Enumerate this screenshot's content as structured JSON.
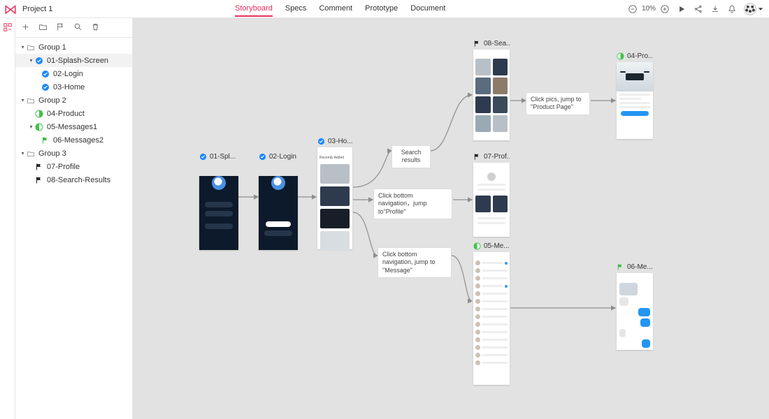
{
  "project_name": "Project 1",
  "tabs": [
    "Storyboard",
    "Specs",
    "Comment",
    "Prototype",
    "Document"
  ],
  "active_tab": 0,
  "zoom": "10%",
  "sidebar": {
    "groups": [
      {
        "label": "Group 1",
        "items": [
          {
            "label": "01-Splash-Screen",
            "status": "check-blue",
            "children": [
              {
                "label": "02-Login",
                "status": "check-blue"
              },
              {
                "label": "03-Home",
                "status": "check-blue"
              }
            ]
          }
        ]
      },
      {
        "label": "Group 2",
        "items": [
          {
            "label": "04-Product",
            "status": "half-green"
          },
          {
            "label": "05-Messages1",
            "status": "half-green-alt",
            "children": [
              {
                "label": "06-Messages2",
                "status": "flag-green"
              }
            ]
          }
        ]
      },
      {
        "label": "Group 3",
        "items": [
          {
            "label": "07-Profile",
            "status": "flag-black"
          },
          {
            "label": "08-Search-Results",
            "status": "flag-black"
          }
        ]
      }
    ]
  },
  "canvas": {
    "nodes": {
      "n01": {
        "label": "01-Spl...",
        "status": "check-blue"
      },
      "n02": {
        "label": "02-Login",
        "status": "check-blue"
      },
      "n03": {
        "label": "03-Ho...",
        "status": "check-blue"
      },
      "n04": {
        "label": "04-Pro...",
        "status": "half-green"
      },
      "n05": {
        "label": "05-Me...",
        "status": "half-green-alt"
      },
      "n06": {
        "label": "06-Me...",
        "status": "flag-green"
      },
      "n07": {
        "label": "07-Prof...",
        "status": "flag-black"
      },
      "n08": {
        "label": "08-Sea...",
        "status": "flag-black"
      }
    },
    "notes": {
      "search": "Search results",
      "profile": "Click bottom navigation，jump to\"Profile\"",
      "message": "Click bottom navigation, jump to \"Message\"",
      "product": "Click pics, jump to \"Product Page\""
    },
    "home_section": "Recently Added"
  }
}
